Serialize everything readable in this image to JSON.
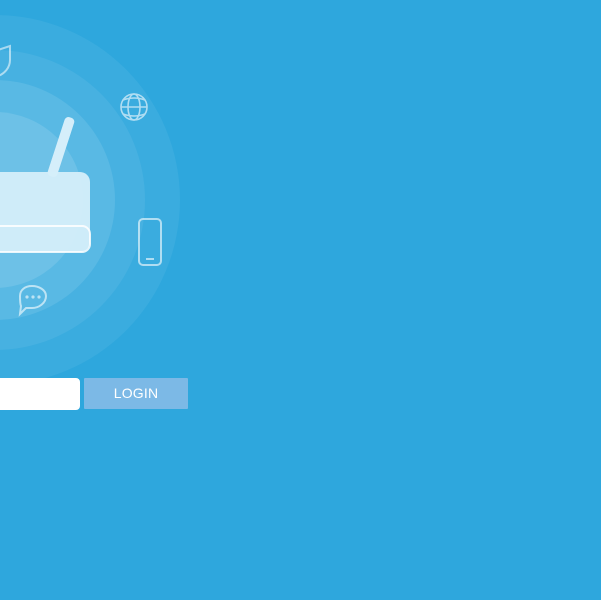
{
  "login_form": {
    "password_value": "",
    "login_label": "LOGIN"
  },
  "colors": {
    "background": "#2ea7dd",
    "login_button": "#7cb9e6",
    "input_background": "#ffffff",
    "text_on_button": "#ffffff"
  },
  "hero": {
    "icons": [
      "router-icon",
      "shield-icon",
      "globe-icon",
      "phone-icon",
      "chat-bubble-icon"
    ]
  }
}
